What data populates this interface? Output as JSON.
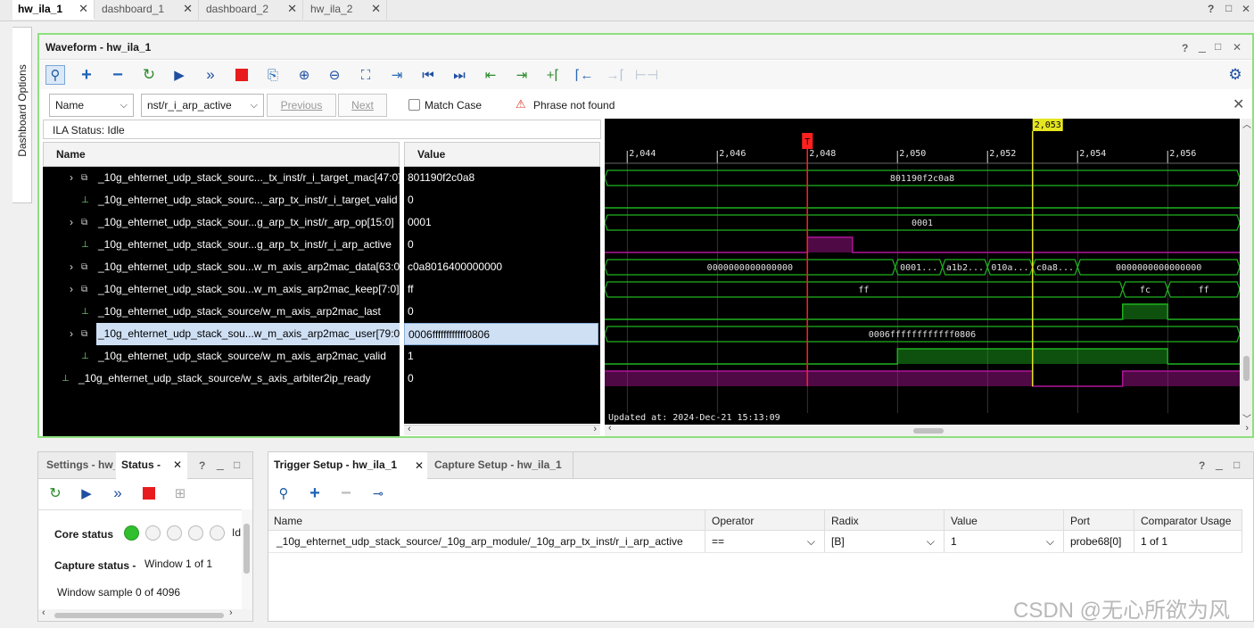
{
  "top_tabs": [
    {
      "label": "hw_ila_1"
    },
    {
      "label": "dashboard_1"
    },
    {
      "label": "dashboard_2"
    },
    {
      "label": "hw_ila_2"
    }
  ],
  "window_controls": {
    "help": "?",
    "restore": "□",
    "close": "✕"
  },
  "side_tab": "Dashboard Options",
  "waveform": {
    "title": "Waveform - hw_ila_1",
    "search": {
      "field_select": "Name",
      "value": "nst/r_i_arp_active",
      "previous": "Previous",
      "next": "Next",
      "match_case": "Match Case",
      "message": "Phrase not found"
    },
    "ila_status": "ILA Status: Idle",
    "name_header": "Name",
    "value_header": "Value",
    "rows": [
      {
        "name": "_10g_ehternet_udp_stack_sourc..._tx_inst/r_i_target_mac[47:0]",
        "value": "801190f2c0a8"
      },
      {
        "name": "_10g_ehternet_udp_stack_sourc..._arp_tx_inst/r_i_target_valid",
        "value": "0"
      },
      {
        "name": "_10g_ehternet_udp_stack_sour...g_arp_tx_inst/r_arp_op[15:0]",
        "value": "0001"
      },
      {
        "name": "_10g_ehternet_udp_stack_sour...g_arp_tx_inst/r_i_arp_active",
        "value": "0"
      },
      {
        "name": "_10g_ehternet_udp_stack_sou...w_m_axis_arp2mac_data[63:0]",
        "value": "c0a8016400000000"
      },
      {
        "name": "_10g_ehternet_udp_stack_sou...w_m_axis_arp2mac_keep[7:0]",
        "value": "ff"
      },
      {
        "name": "_10g_ehternet_udp_stack_source/w_m_axis_arp2mac_last",
        "value": "0"
      },
      {
        "name": "_10g_ehternet_udp_stack_sou...w_m_axis_arp2mac_user[79:0]",
        "value": "0006ffffffffffff0806"
      },
      {
        "name": "_10g_ehternet_udp_stack_source/w_m_axis_arp2mac_valid",
        "value": "1"
      },
      {
        "name": "_10g_ehternet_udp_stack_source/w_s_axis_arbiter2ip_ready",
        "value": "0"
      }
    ],
    "time_ticks": [
      "2,044",
      "2,046",
      "2,048",
      "2,050",
      "2,052",
      "2,054",
      "2,056"
    ],
    "cursor_label": "T",
    "marker_label": "2,053",
    "bus_labels": {
      "mac": "801190f2c0a8",
      "op": "0001",
      "data_0": "0000000000000000",
      "data_1": "0001...",
      "data_2": "a1b2...",
      "data_3": "010a...",
      "data_4": "c0a8...",
      "data_5": "0000000000000000",
      "keep_0": "ff",
      "keep_1": "fc",
      "keep_2": "ff",
      "user": "0006ffffffffffff0806"
    },
    "updated": "Updated at: 2024-Dec-21 15:13:09"
  },
  "status_panel": {
    "tab_settings": "Settings - hw_",
    "tab_status": "Status -",
    "core_status_label": "Core status",
    "core_status_trailing": "Id",
    "capture_status_label": "Capture status -",
    "window_text": "Window 1 of 1",
    "window_sample": "Window sample 0 of 4096"
  },
  "trigger_panel": {
    "tab_trigger": "Trigger Setup - hw_ila_1",
    "tab_capture": "Capture Setup - hw_ila_1",
    "columns": [
      "Name",
      "Operator",
      "Radix",
      "Value",
      "Port",
      "Comparator Usage"
    ],
    "row": {
      "name": "_10g_ehternet_udp_stack_source/_10g_arp_module/_10g_arp_tx_inst/r_i_arp_active",
      "operator": "==",
      "radix": "[B]",
      "value": "1",
      "port": "probe68[0]",
      "comparator_usage": "1 of 1"
    }
  },
  "watermark": "CSDN @无心所欲为风",
  "colors": {
    "panel_border": "#8ee07e",
    "wave_green": "#1fb31f",
    "wave_magenta": "#b0159a",
    "cursor_red": "#ff2020",
    "marker_yellow": "#e5e520",
    "selected_row": "#cfe0f5"
  }
}
